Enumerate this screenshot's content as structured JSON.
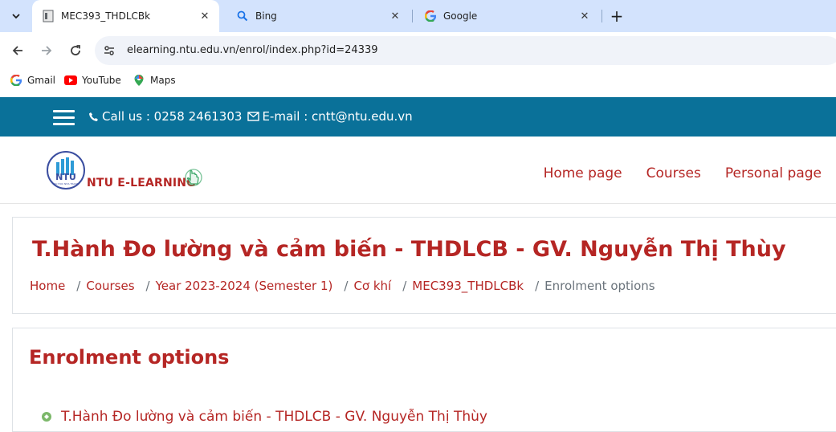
{
  "browser": {
    "tabs": [
      {
        "title": "MEC393_THDLCBk",
        "active": true,
        "icon": "document-icon"
      },
      {
        "title": "Bing",
        "active": false,
        "icon": "bing-search-icon"
      },
      {
        "title": "Google",
        "active": false,
        "icon": "google-icon"
      }
    ],
    "url": "elearning.ntu.edu.vn/enrol/index.php?id=24339",
    "bookmarks": [
      {
        "label": "Gmail",
        "icon": "google-icon"
      },
      {
        "label": "YouTube",
        "icon": "youtube-icon"
      },
      {
        "label": "Maps",
        "icon": "maps-icon"
      }
    ]
  },
  "site": {
    "topbar": {
      "call_label": "Call us : 0258 2461303",
      "email_label": "E-mail : cntt@ntu.edu.vn",
      "background": "#0a7199"
    },
    "logo_text": "NTU E-LEARNING",
    "nav": [
      {
        "label": "Home page"
      },
      {
        "label": "Courses"
      },
      {
        "label": "Personal page"
      }
    ],
    "accent": "#b52624"
  },
  "page": {
    "title": "T.Hành Đo lường và cảm biến - THDLCB - GV. Nguyễn Thị Thùy",
    "breadcrumb": [
      {
        "label": "Home"
      },
      {
        "label": "Courses"
      },
      {
        "label": "Year 2023-2024 (Semester 1)"
      },
      {
        "label": "Cơ khí"
      },
      {
        "label": "MEC393_THDLCBk"
      },
      {
        "label": "Enrolment options"
      }
    ],
    "section_title": "Enrolment options",
    "course_link": "T.Hành Đo lường và cảm biến - THDLCB - GV. Nguyễn Thị Thùy"
  }
}
